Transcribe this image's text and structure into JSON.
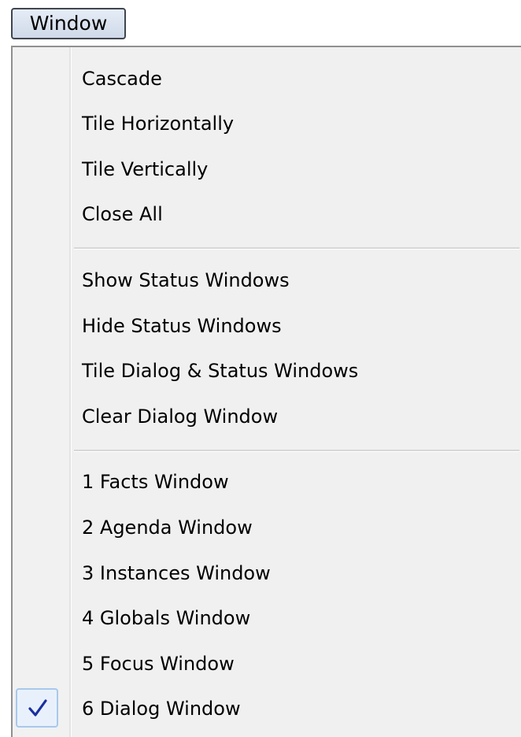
{
  "menu": {
    "title": "Window"
  },
  "groups": [
    [
      {
        "label": "Cascade"
      },
      {
        "label": "Tile Horizontally"
      },
      {
        "label": "Tile Vertically"
      },
      {
        "label": "Close All"
      }
    ],
    [
      {
        "label": "Show Status Windows"
      },
      {
        "label": "Hide Status Windows"
      },
      {
        "label": "Tile Dialog & Status Windows"
      },
      {
        "label": "Clear Dialog Window"
      }
    ],
    [
      {
        "label": "1 Facts Window"
      },
      {
        "label": "2 Agenda Window"
      },
      {
        "label": "3 Instances Window"
      },
      {
        "label": "4 Globals Window"
      },
      {
        "label": "5 Focus Window"
      },
      {
        "label": "6 Dialog Window",
        "checked": true
      }
    ]
  ],
  "colors": {
    "check": "#1a2fa0",
    "check_highlight": "#a8c8ec"
  },
  "icons": {
    "checked_item": "checkmark-icon"
  }
}
